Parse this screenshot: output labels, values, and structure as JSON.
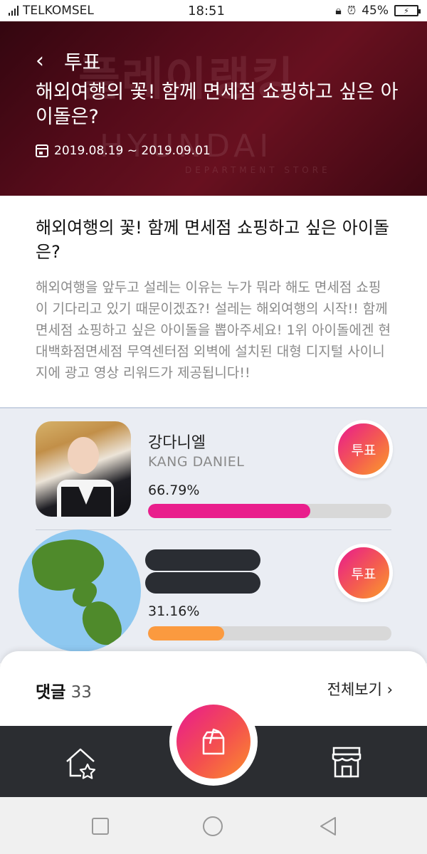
{
  "status_bar": {
    "carrier": "TELKOMSEL",
    "time": "18:51",
    "battery": "45%",
    "icons": [
      "signal-icon",
      "lock-rotation-icon",
      "alarm-icon",
      "battery-charging-icon"
    ]
  },
  "header": {
    "back_label": "투표",
    "title": "해외여행의 꽃! 함께 면세점 쇼핑하고 싶은 아이돌은?",
    "date_range": "2019.08.19 ~ 2019.09.01",
    "banner_text": "플레이랭킹",
    "banner_brand": "HYUNDAI",
    "banner_sub": "DEPARTMENT STORE"
  },
  "description": {
    "heading": "해외여행의 꽃! 함께 면세점 쇼핑하고 싶은 아이돌은?",
    "body": "해외여행을 앞두고 설레는 이유는 누가 뭐라 해도 면세점 쇼핑이 기다리고 있기 때문이겠죠?! 설레는 해외여행의 시작!! 함께 면세점 쇼핑하고 싶은 아이돌을 뽑아주세요! 1위 아이돌에겐 현대백화점면세점 무역센터점 외벽에 설치된 대형 디지털 사이니지에 광고 영상 리워드가 제공됩니다!!"
  },
  "candidates": [
    {
      "name": "강다니엘",
      "name_en": "KANG DANIEL",
      "percent_label": "66.79%",
      "percent": 66.79,
      "color": "#e91e8c",
      "vote_label": "투표"
    },
    {
      "name": "",
      "name_en": "",
      "percent_label": "31.16%",
      "percent": 31.16,
      "color": "#fb9a3f",
      "vote_label": "투표"
    }
  ],
  "comments": {
    "label": "댓글",
    "count": "33",
    "view_all": "전체보기 ›"
  },
  "bottom_nav": {
    "items": [
      "home-star-icon",
      "ballot-box-icon",
      "store-icon"
    ]
  },
  "colors": {
    "accent_pink": "#e81a8f",
    "accent_orange": "#fb9d2a",
    "nav_bg": "#2b2d31",
    "list_bg": "#eaedf3"
  }
}
